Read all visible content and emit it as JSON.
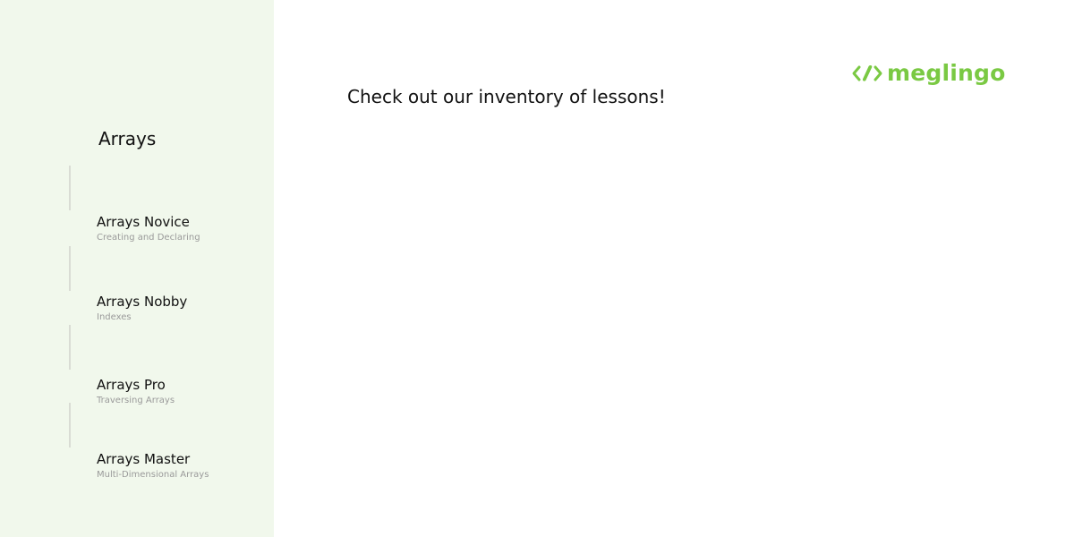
{
  "brand": {
    "name": "meglingo",
    "color": "#7ac943",
    "icon": "code-brackets-icon"
  },
  "main": {
    "headline": "Check out our inventory of lessons!"
  },
  "sidebar": {
    "title": "Arrays",
    "background": "#f1f8ec",
    "lessons": [
      {
        "title": "Arrays Novice",
        "subtitle": "Creating and Declaring"
      },
      {
        "title": "Arrays Nobby",
        "subtitle": "Indexes"
      },
      {
        "title": "Arrays Pro",
        "subtitle": "Traversing Arrays"
      },
      {
        "title": "Arrays Master",
        "subtitle": "Multi-Dimensional Arrays"
      }
    ]
  }
}
